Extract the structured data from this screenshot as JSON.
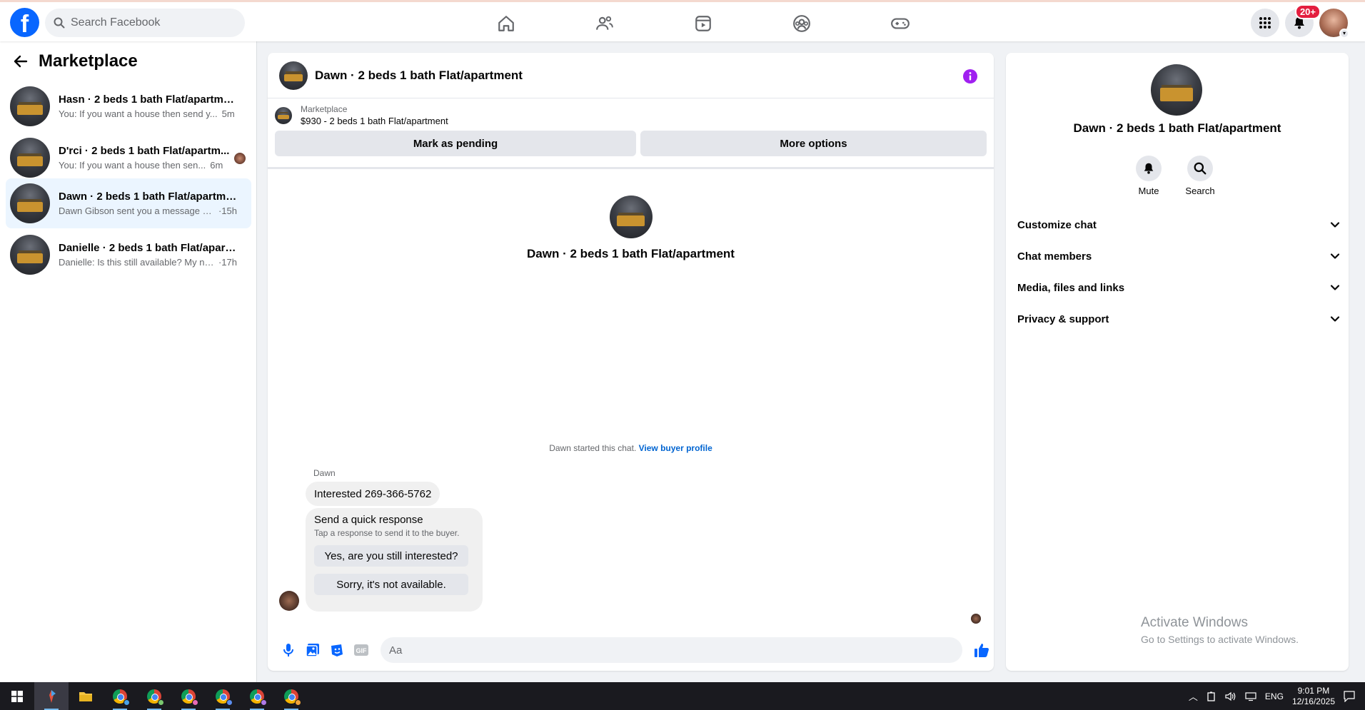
{
  "search": {
    "placeholder": "Search Facebook"
  },
  "notifications": {
    "badge": "20+"
  },
  "sidebar": {
    "title": "Marketplace",
    "conversations": [
      {
        "title": "Hasn · 2 beds 1 bath Flat/apartment",
        "snippet": "You: If you want a house then send y...",
        "time": "5m",
        "active": false
      },
      {
        "title": "D'rci · 2 beds 1 bath Flat/apartm...",
        "snippet": "You: If you want a house then sen...",
        "time": "6m",
        "active": false
      },
      {
        "title": "Dawn · 2 beds 1 bath Flat/apartment",
        "snippet": "Dawn Gibson sent you a message ab...",
        "time": "·15h",
        "active": true
      },
      {
        "title": "Danielle · 2 beds 1 bath Flat/apart...",
        "snippet": "Danielle: Is this still available? My nu...",
        "time": "·17h",
        "active": false
      }
    ]
  },
  "chat": {
    "title": "Dawn · 2 beds 1 bath Flat/apartment",
    "listing_label": "Marketplace",
    "listing_price": "$930 - 2 beds 1 bath Flat/apartment",
    "mark_pending": "Mark as pending",
    "more_options": "More options",
    "intro_title": "Dawn · 2 beds 1 bath Flat/apartment",
    "started_text": "Dawn started this chat.",
    "view_buyer_profile": "View buyer profile",
    "sender_name": "Dawn",
    "message": "Interested 269-366-5762",
    "quick_title": "Send a quick response",
    "quick_sub": "Tap a response to send it to the buyer.",
    "quick_yes": "Yes, are you still interested?",
    "quick_no": "Sorry, it's not available.",
    "input_placeholder": "Aa"
  },
  "details": {
    "title": "Dawn · 2 beds 1 bath Flat/apartment",
    "mute": "Mute",
    "search": "Search",
    "sections": [
      "Customize chat",
      "Chat members",
      "Media, files and links",
      "Privacy & support"
    ]
  },
  "watermark": {
    "line1": "Activate Windows",
    "line2": "Go to Settings to activate Windows."
  },
  "taskbar": {
    "lang": "ENG",
    "time": "9:01 PM",
    "date": "12/16/2025"
  },
  "colors": {
    "brand_blue": "#0866ff",
    "link_blue": "#0064d1",
    "accent_purple": "#a020f0",
    "active_conv_bg": "#ebf5ff",
    "badge_red": "#e41e3f"
  }
}
